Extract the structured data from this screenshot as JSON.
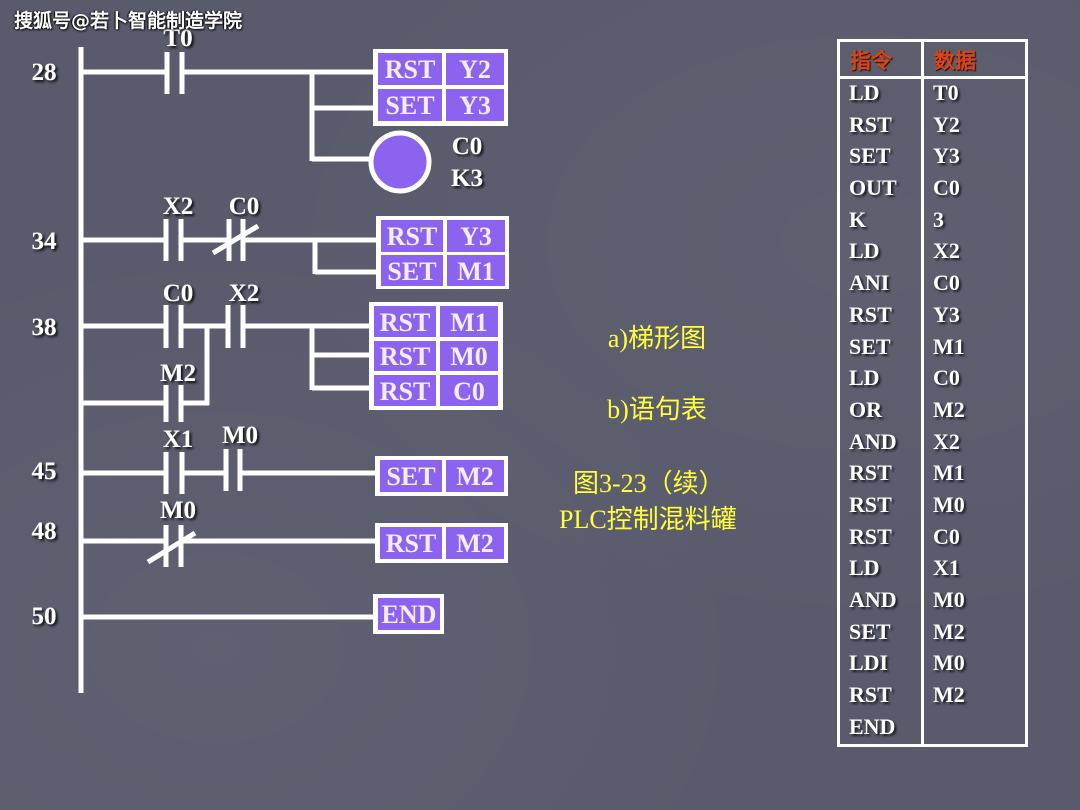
{
  "watermark": "搜狐号@若卜智能制造学院",
  "ladder": {
    "rungs": [
      {
        "step": "28",
        "contacts": [
          {
            "label": "T0",
            "type": "normally-open"
          }
        ],
        "outputs": [
          {
            "op": "RST",
            "operand": "Y2"
          },
          {
            "op": "SET",
            "operand": "Y3"
          }
        ],
        "coil": {
          "device": "C0",
          "preset": "K3"
        }
      },
      {
        "step": "34",
        "contacts": [
          {
            "label": "X2",
            "type": "normally-open"
          },
          {
            "label": "C0",
            "type": "normally-closed"
          }
        ],
        "outputs": [
          {
            "op": "RST",
            "operand": "Y3"
          },
          {
            "op": "SET",
            "operand": "M1"
          }
        ]
      },
      {
        "step": "38",
        "contacts": [
          {
            "label": "C0",
            "type": "normally-open"
          },
          {
            "label": "X2",
            "type": "normally-open"
          }
        ],
        "parallel_contacts": [
          {
            "label": "M2",
            "type": "normally-open"
          }
        ],
        "outputs": [
          {
            "op": "RST",
            "operand": "M1"
          },
          {
            "op": "RST",
            "operand": "M0"
          },
          {
            "op": "RST",
            "operand": "C0"
          }
        ]
      },
      {
        "step": "45",
        "contacts": [
          {
            "label": "X1",
            "type": "normally-open"
          },
          {
            "label": "M0",
            "type": "normally-open"
          }
        ],
        "outputs": [
          {
            "op": "SET",
            "operand": "M2"
          }
        ]
      },
      {
        "step": "48",
        "contacts": [
          {
            "label": "M0",
            "type": "normally-closed"
          }
        ],
        "outputs": [
          {
            "op": "RST",
            "operand": "M2"
          }
        ]
      },
      {
        "step": "50",
        "outputs": [
          {
            "op": "END"
          }
        ]
      }
    ]
  },
  "captions": {
    "ladder_caption": "a)梯形图",
    "statement_caption": "b)语句表",
    "figure_number": "图3-23（续）",
    "figure_title": "PLC控制混料罐"
  },
  "instruction_table": {
    "headers": {
      "instruction": "指令",
      "data": "数据"
    },
    "rows": [
      {
        "instr": "LD",
        "data": "T0"
      },
      {
        "instr": "RST",
        "data": "Y2"
      },
      {
        "instr": "SET",
        "data": "Y3"
      },
      {
        "instr": "OUT",
        "data": "C0"
      },
      {
        "instr": "K",
        "data": "3"
      },
      {
        "instr": "LD",
        "data": "X2"
      },
      {
        "instr": "ANI",
        "data": "C0"
      },
      {
        "instr": "RST",
        "data": "Y3"
      },
      {
        "instr": "SET",
        "data": "M1"
      },
      {
        "instr": "LD",
        "data": "C0"
      },
      {
        "instr": "OR",
        "data": "M2"
      },
      {
        "instr": "AND",
        "data": "X2"
      },
      {
        "instr": "RST",
        "data": "M1"
      },
      {
        "instr": "RST",
        "data": "M0"
      },
      {
        "instr": "RST",
        "data": "C0"
      },
      {
        "instr": "LD",
        "data": "X1"
      },
      {
        "instr": "AND",
        "data": "M0"
      },
      {
        "instr": "SET",
        "data": "M2"
      },
      {
        "instr": "LDI",
        "data": "M0"
      },
      {
        "instr": "RST",
        "data": "M2"
      },
      {
        "instr": "END",
        "data": ""
      }
    ]
  },
  "colors": {
    "background": "#595b6c",
    "element_fill": "#8b63ee",
    "wire": "#ffffff",
    "caption": "#ffff3c",
    "table_header": "#d9441a"
  }
}
